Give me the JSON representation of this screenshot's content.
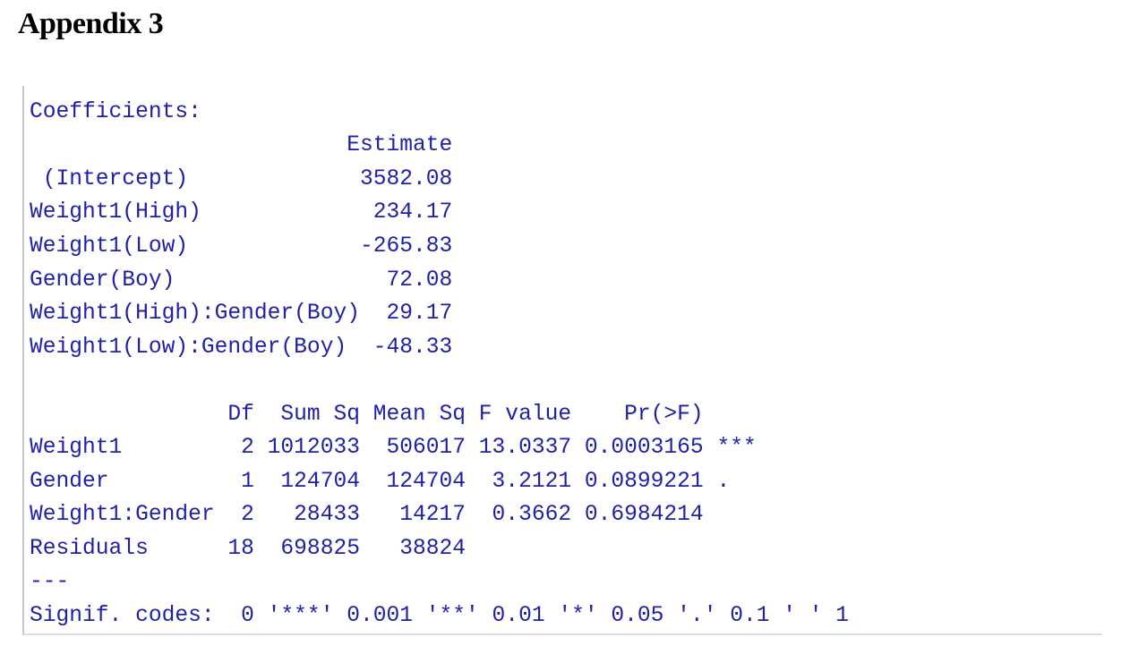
{
  "document": {
    "title": "Appendix 3"
  },
  "console": {
    "lines": [
      "Coefficients:",
      "                        Estimate",
      " (Intercept)             3582.08",
      "Weight1(High)             234.17",
      "Weight1(Low)             -265.83",
      "Gender(Boy)                72.08",
      "Weight1(High):Gender(Boy)  29.17",
      "Weight1(Low):Gender(Boy)  -48.33",
      "",
      "               Df  Sum Sq Mean Sq F value    Pr(>F)",
      "Weight1         2 1012033  506017 13.0337 0.0003165 ***",
      "Gender          1  124704  124704  3.2121 0.0899221 .",
      "Weight1:Gender  2   28433   14217  0.3662 0.6984214",
      "Residuals      18  698825   38824",
      "---",
      "Signif. codes:  0 '***' 0.001 '**' 0.01 '*' 0.05 '.' 0.1 ' ' 1"
    ]
  }
}
